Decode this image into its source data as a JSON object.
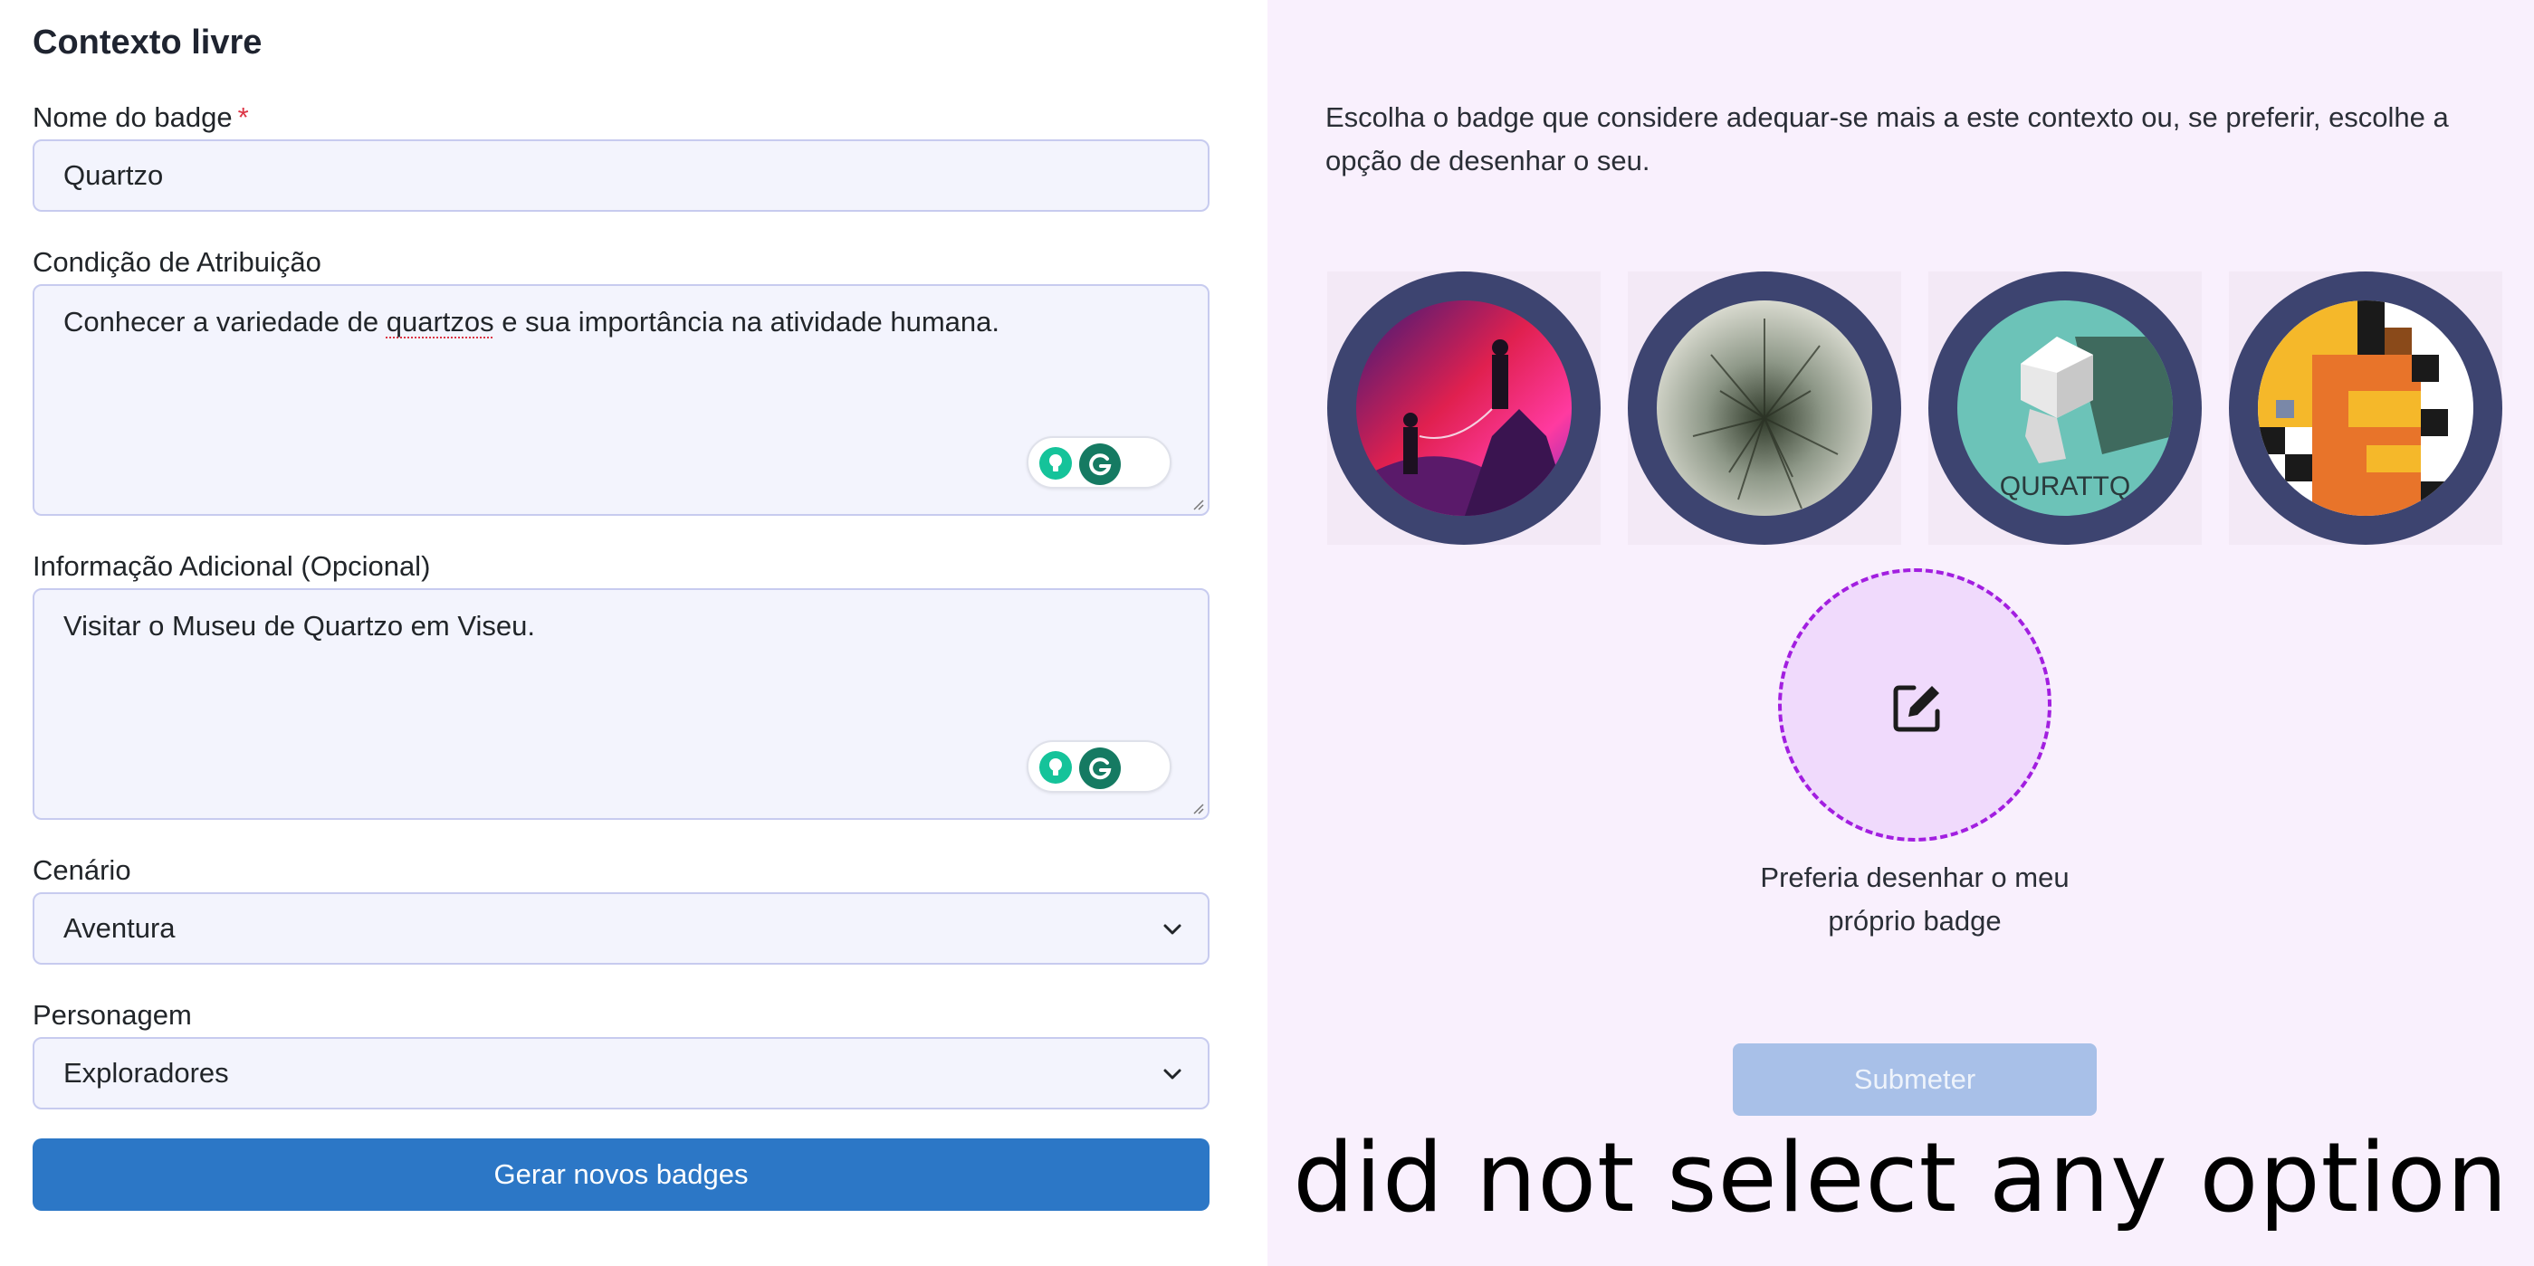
{
  "form": {
    "title": "Contexto livre",
    "badge_name": {
      "label": "Nome do badge",
      "required_mark": "*",
      "value": "Quartzo"
    },
    "condition": {
      "label": "Condição de Atribuição",
      "value_before": "Conhecer a variedade de ",
      "value_misspelled": "quartzos",
      "value_after": " e sua importância na atividade humana."
    },
    "additional": {
      "label": "Informação Adicional (Opcional)",
      "value": "Visitar o Museu de Quartzo em Viseu."
    },
    "scenario": {
      "label": "Cenário",
      "selected": "Aventura"
    },
    "character": {
      "label": "Personagem",
      "selected": "Exploradores"
    },
    "generate_button": "Gerar novos badges"
  },
  "badges_panel": {
    "intro": "Escolha o badge que considere adequar-se mais a este contexto ou, se preferir, escolhe a opção de desenhar o seu.",
    "badges": [
      {
        "name": "badge-option-1",
        "image": "people-on-mountain"
      },
      {
        "name": "badge-option-2",
        "image": "crystal-texture"
      },
      {
        "name": "badge-option-3",
        "image": "quartz-crystal",
        "caption": "QURATTQ"
      },
      {
        "name": "badge-option-4",
        "image": "pixel-art-quartz"
      }
    ],
    "draw_own": {
      "icon": "pencil-edit-icon",
      "label": "Preferia desenhar o meu próprio badge"
    },
    "submit_button": "Submeter",
    "status_message": "did not select any option"
  },
  "colors": {
    "primary": "#2c77c6",
    "submit_disabled": "#a8c0e8",
    "badge_ring": "#3d4470",
    "panel_bg": "#f9f0fd",
    "draw_dashed": "#a21ee0",
    "required": "#dc3545"
  }
}
